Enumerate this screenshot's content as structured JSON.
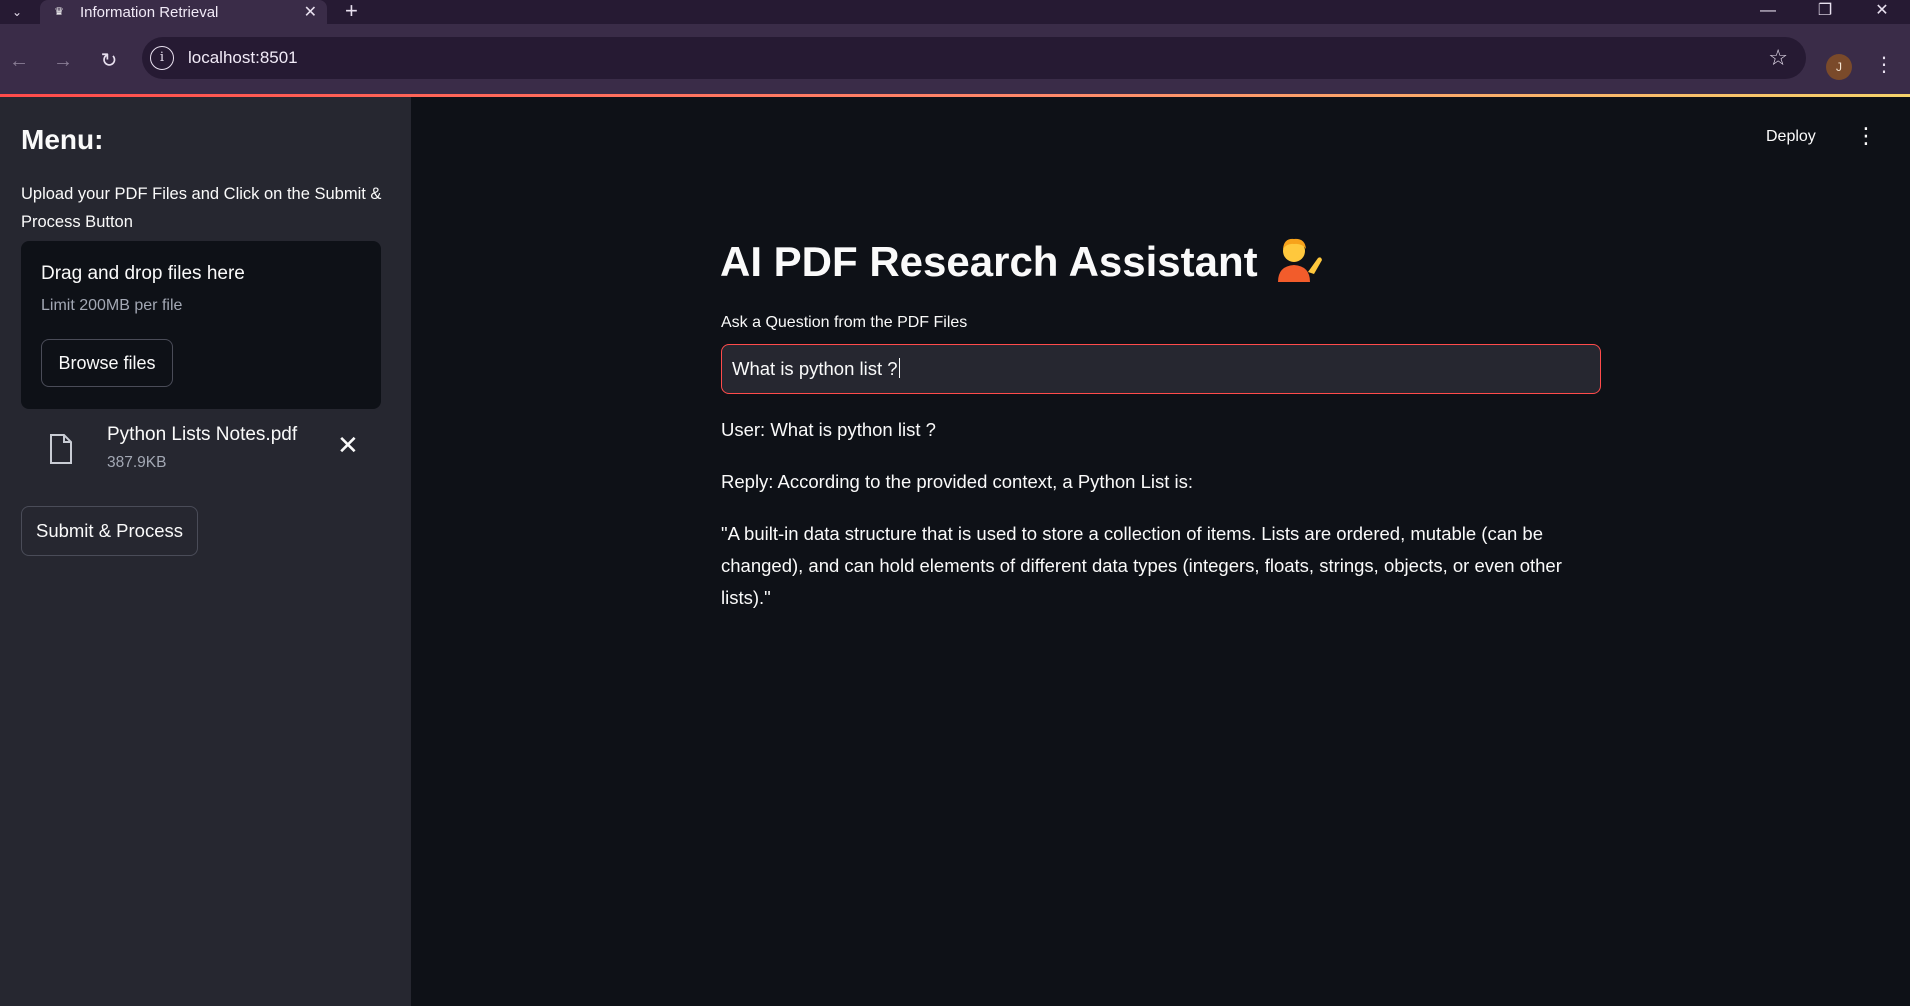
{
  "browser": {
    "tab_title": "Information Retrieval",
    "url": "localhost:8501",
    "profile_initial": "J"
  },
  "sidebar": {
    "title": "Menu:",
    "description": "Upload your PDF Files and Click on the Submit & Process Button",
    "dropzone": {
      "title": "Drag and drop files here",
      "limit": "Limit 200MB per file",
      "browse_label": "Browse files"
    },
    "uploaded_file": {
      "name": "Python Lists Notes.pdf",
      "size": "387.9KB"
    },
    "submit_label": "Submit & Process"
  },
  "header": {
    "deploy_label": "Deploy"
  },
  "main": {
    "title": "AI PDF Research Assistant",
    "question_label": "Ask a Question from the PDF Files",
    "question_value": "What is python list ?",
    "user_line": "User: What is python list ?",
    "reply_line": "Reply: According to the provided context, a Python List is:",
    "quote": "\"A built-in data structure that is used to store a collection of items. Lists are ordered, mutable (can be changed), and can hold elements of different data types (integers, floats, strings, objects, or even other lists).\""
  },
  "colors": {
    "accent": "#ff4b4b",
    "background": "#0e1117",
    "sidebar_bg": "#262730",
    "browser_frame": "#3a2c48"
  }
}
